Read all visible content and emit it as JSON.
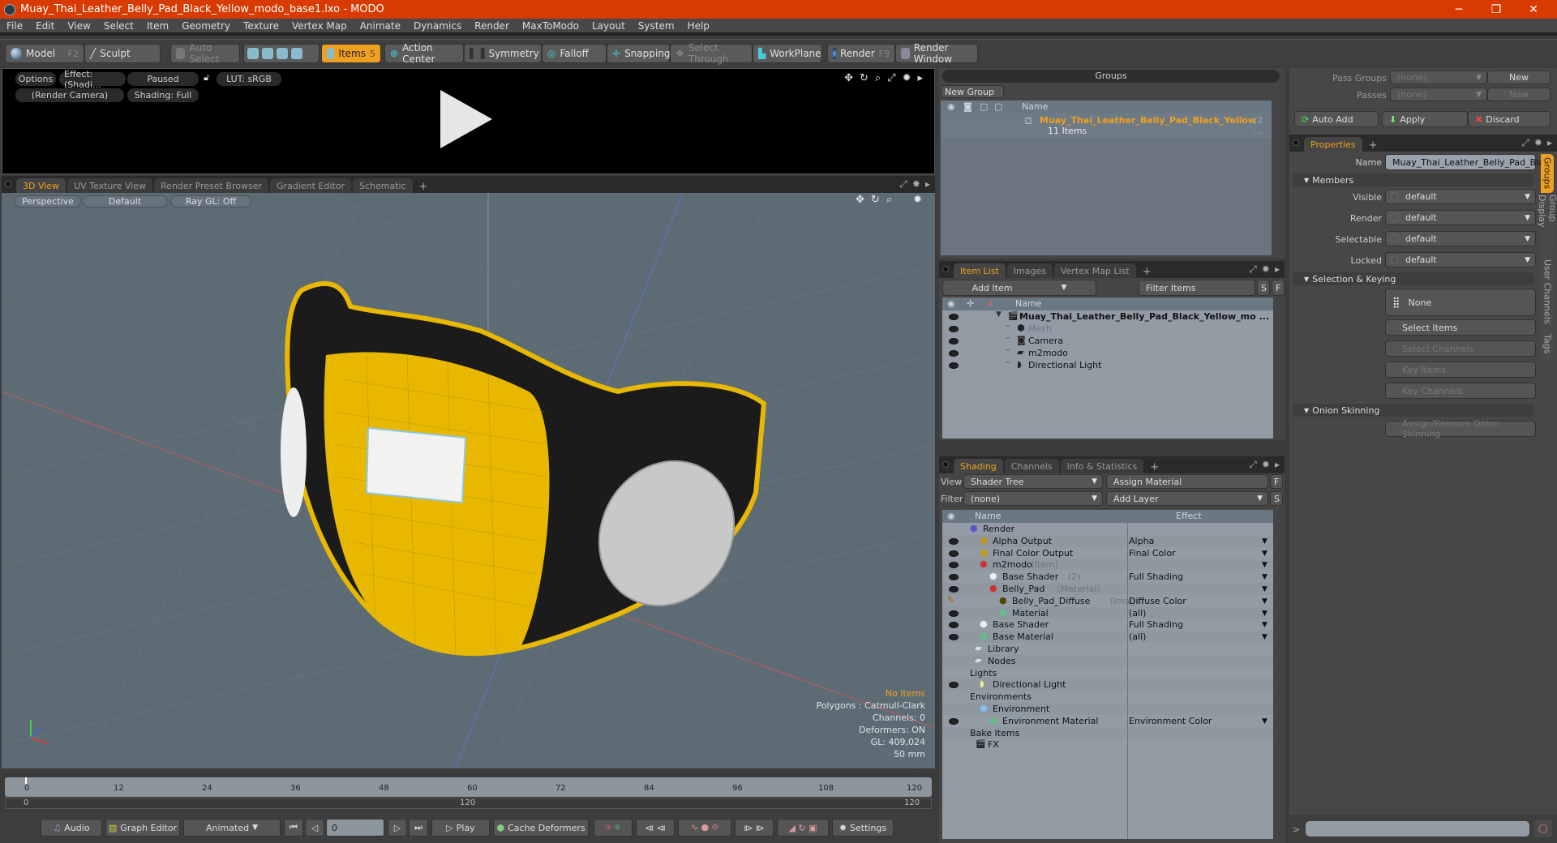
{
  "window": {
    "title": "Muay_Thai_Leather_Belly_Pad_Black_Yellow_modo_base1.lxo - MODO",
    "minimize": "─",
    "maximize": "❐",
    "close": "✕"
  },
  "menu": [
    "File",
    "Edit",
    "View",
    "Select",
    "Item",
    "Geometry",
    "Texture",
    "Vertex Map",
    "Animate",
    "Dynamics",
    "Render",
    "MaxToModo",
    "Layout",
    "System",
    "Help"
  ],
  "toolbar": {
    "model": "Model",
    "model_key": "F2",
    "sculpt": "Sculpt",
    "auto_select": "Auto Select",
    "items": "Items",
    "items_count": "5",
    "action_center": "Action Center",
    "symmetry": "Symmetry",
    "falloff": "Falloff",
    "snapping": "Snapping",
    "select_through": "Select Through",
    "workplane": "WorkPlane",
    "render": "Render",
    "render_key": "F9",
    "render_window": "Render Window"
  },
  "preview": {
    "options": "Options",
    "effect": "Effect: (Shadi...",
    "paused": "Paused",
    "lut": "LUT: sRGB",
    "camera": "(Render Camera)",
    "shading": "Shading: Full"
  },
  "viewport_tabs": [
    "3D View",
    "UV Texture View",
    "Render Preset Browser",
    "Gradient Editor",
    "Schematic"
  ],
  "viewport": {
    "perspective": "Perspective",
    "default": "Default",
    "raygl": "Ray GL: Off",
    "stats": {
      "items": "No Items",
      "polygons": "Polygons : Catmull-Clark",
      "channels": "Channels: 0",
      "deformers": "Deformers: ON",
      "gl": "GL: 409,024",
      "scale": "50 mm"
    }
  },
  "timeline": {
    "ticks": [
      "0",
      "12",
      "24",
      "36",
      "48",
      "60",
      "72",
      "84",
      "96",
      "108",
      "120"
    ],
    "range_start": "0",
    "range_mid": "120",
    "range_end": "120"
  },
  "transport": {
    "audio": "Audio",
    "graph_editor": "Graph Editor",
    "animated": "Animated",
    "frame": "0",
    "play": "Play",
    "cache_deformers": "Cache Deformers",
    "settings": "Settings"
  },
  "groups": {
    "title": "Groups",
    "new_group": "New Group",
    "col_name": "Name",
    "item_name": "Muay_Thai_Leather_Belly_Pad_Black_Yellow",
    "item_suffix": "(2 ...",
    "item_count": "11 Items"
  },
  "itemlist": {
    "tabs": [
      "Item List",
      "Images",
      "Vertex Map List"
    ],
    "add_item": "Add Item",
    "filter": "Filter Items",
    "s": "S",
    "f": "F",
    "col_name": "Name",
    "rows": [
      {
        "name": "Muay_Thai_Leather_Belly_Pad_Black_Yellow_mo ...",
        "indent": 0,
        "icon": "scene-icon",
        "bold": true
      },
      {
        "name": "Mesh",
        "indent": 1,
        "icon": "mesh-icon",
        "dim": true
      },
      {
        "name": "Camera",
        "indent": 1,
        "icon": "camera-icon"
      },
      {
        "name": "m2modo",
        "indent": 1,
        "icon": "group-folder-icon"
      },
      {
        "name": "Directional Light",
        "indent": 1,
        "icon": "light-icon"
      }
    ]
  },
  "shading": {
    "tabs": [
      "Shading",
      "Channels",
      "Info & Statistics"
    ],
    "view_label": "View",
    "view_value": "Shader Tree",
    "assign_material": "Assign Material",
    "filter_label": "Filter",
    "filter_value": "(none)",
    "add_layer": "Add Layer",
    "f": "F",
    "s": "S",
    "col_name": "Name",
    "col_effect": "Effect",
    "rows": [
      {
        "name": "Render",
        "sub": "",
        "effect": "",
        "indent": 0,
        "icon": "render-sphere-icon",
        "eye": false,
        "dd": false
      },
      {
        "name": "Alpha Output",
        "sub": "",
        "effect": "Alpha",
        "indent": 1,
        "icon": "output-icon",
        "eye": true,
        "dd": true
      },
      {
        "name": "Final Color Output",
        "sub": "",
        "effect": "Final Color",
        "indent": 1,
        "icon": "output-icon",
        "eye": true,
        "dd": true
      },
      {
        "name": "m2modo",
        "sub": "(Item)",
        "effect": "",
        "indent": 1,
        "icon": "mask-icon",
        "eye": true,
        "dd": true
      },
      {
        "name": "Base Shader",
        "sub": "(2)",
        "effect": "Full Shading",
        "indent": 2,
        "icon": "shader-icon",
        "eye": true,
        "dd": true
      },
      {
        "name": "Belly_Pad",
        "sub": "(Material)",
        "effect": "",
        "indent": 2,
        "icon": "mask-icon",
        "eye": true,
        "dd": true
      },
      {
        "name": "Belly_Pad_Diffuse",
        "sub": "(Image)",
        "effect": "Diffuse Color",
        "indent": 3,
        "icon": "image-icon",
        "eye": "brush",
        "dd": true
      },
      {
        "name": "Material",
        "sub": "",
        "effect": "(all)",
        "indent": 3,
        "icon": "material-icon",
        "eye": true,
        "dd": true
      },
      {
        "name": "Base Shader",
        "sub": "",
        "effect": "Full Shading",
        "indent": 1,
        "icon": "shader-icon",
        "eye": true,
        "dd": true
      },
      {
        "name": "Base Material",
        "sub": "",
        "effect": "(all)",
        "indent": 1,
        "icon": "material-icon",
        "eye": true,
        "dd": true
      },
      {
        "name": "Library",
        "sub": "",
        "effect": "",
        "indent": 0.5,
        "icon": "folder-icon",
        "eye": false,
        "dd": false
      },
      {
        "name": "Nodes",
        "sub": "",
        "effect": "",
        "indent": 0.5,
        "icon": "folder-icon",
        "eye": false,
        "dd": false
      },
      {
        "name": "Lights",
        "sub": "",
        "effect": "",
        "indent": 0,
        "icon": "",
        "eye": false,
        "dd": false
      },
      {
        "name": "Directional Light",
        "sub": "",
        "effect": "",
        "indent": 1,
        "icon": "light-icon",
        "eye": true,
        "dd": false
      },
      {
        "name": "Environments",
        "sub": "",
        "effect": "",
        "indent": 0,
        "icon": "",
        "eye": false,
        "dd": false
      },
      {
        "name": "Environment",
        "sub": "",
        "effect": "",
        "indent": 1,
        "icon": "environment-icon",
        "eye": false,
        "dd": false
      },
      {
        "name": "Environment Material",
        "sub": "",
        "effect": "Environment Color",
        "indent": 2,
        "icon": "material-icon",
        "eye": true,
        "dd": true
      },
      {
        "name": "Bake Items",
        "sub": "",
        "effect": "",
        "indent": 0,
        "icon": "",
        "eye": false,
        "dd": false
      },
      {
        "name": "FX",
        "sub": "",
        "effect": "",
        "indent": 0.5,
        "icon": "fx-icon",
        "eye": false,
        "dd": false
      }
    ]
  },
  "passes": {
    "pass_groups": "Pass Groups",
    "passes": "Passes",
    "none": "(none)",
    "new": "New",
    "auto_add": "Auto Add",
    "apply": "Apply",
    "discard": "Discard"
  },
  "properties": {
    "tab": "Properties",
    "name_label": "Name",
    "name_value": "Muay_Thai_Leather_Belly_Pad_Blac",
    "members": "Members",
    "fields": [
      {
        "label": "Visible",
        "value": "default"
      },
      {
        "label": "Render",
        "value": "default"
      },
      {
        "label": "Selectable",
        "value": "default"
      },
      {
        "label": "Locked",
        "value": "default"
      }
    ],
    "selection_keying": "Selection & Keying",
    "none": "None",
    "select_items": "Select Items",
    "select_channels": "Select Channels",
    "key_items": "Key Items",
    "key_channels": "Key Channels",
    "onion": "Onion Skinning",
    "onion_btn": "Assign/Remove Onion Skinning",
    "side_tabs": [
      "Groups",
      "Group Display",
      "User Channels",
      "Tags"
    ]
  },
  "command": {
    "prompt": ">",
    "value": ""
  },
  "colors": {
    "accent": "#f0a020",
    "title": "#d83b01",
    "mask_yellow": "#e8b800"
  }
}
